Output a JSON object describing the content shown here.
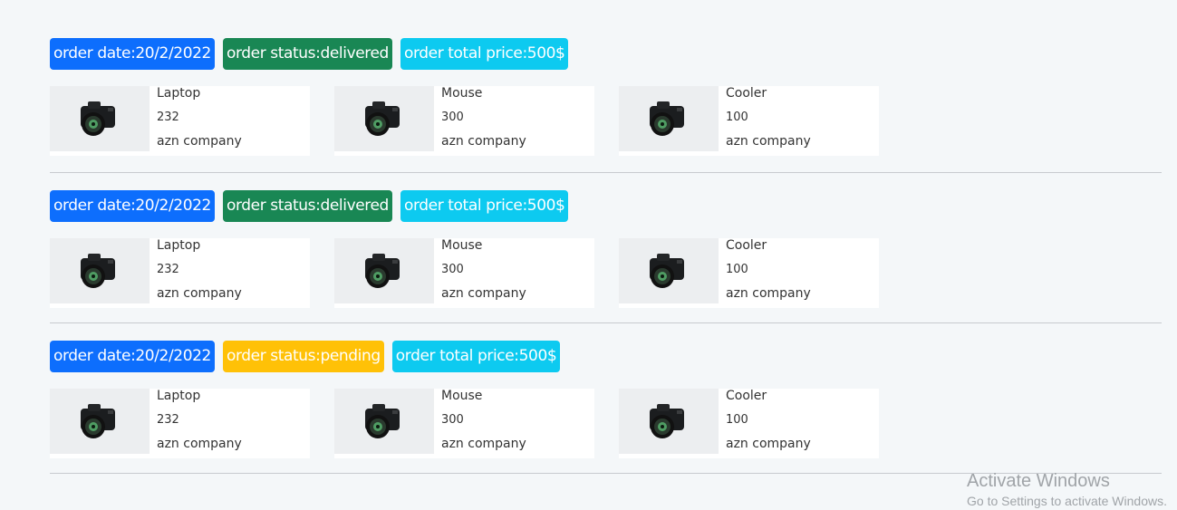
{
  "orders": [
    {
      "date_label": "order date:20/2/2022",
      "status_label": "order status:delivered",
      "status": "delivered",
      "total_label": "order total price:500$",
      "items": [
        {
          "name": "Laptop",
          "price": "232",
          "company": "azn company",
          "image_icon": "camera-icon"
        },
        {
          "name": "Mouse",
          "price": "300",
          "company": "azn company",
          "image_icon": "camera-icon"
        },
        {
          "name": "Cooler",
          "price": "100",
          "company": "azn company",
          "image_icon": "camera-icon"
        }
      ]
    },
    {
      "date_label": "order date:20/2/2022",
      "status_label": "order status:delivered",
      "status": "delivered",
      "total_label": "order total price:500$",
      "items": [
        {
          "name": "Laptop",
          "price": "232",
          "company": "azn company",
          "image_icon": "camera-icon"
        },
        {
          "name": "Mouse",
          "price": "300",
          "company": "azn company",
          "image_icon": "camera-icon"
        },
        {
          "name": "Cooler",
          "price": "100",
          "company": "azn company",
          "image_icon": "camera-icon"
        }
      ]
    },
    {
      "date_label": "order date:20/2/2022",
      "status_label": "order status:pending",
      "status": "pending",
      "total_label": "order total price:500$",
      "items": [
        {
          "name": "Laptop",
          "price": "232",
          "company": "azn company",
          "image_icon": "camera-icon"
        },
        {
          "name": "Mouse",
          "price": "300",
          "company": "azn company",
          "image_icon": "camera-icon"
        },
        {
          "name": "Cooler",
          "price": "100",
          "company": "azn company",
          "image_icon": "camera-icon"
        }
      ]
    }
  ],
  "colors": {
    "date_badge": "#0d6efd",
    "delivered_badge": "#198754",
    "pending_badge": "#ffc107",
    "total_badge": "#0dcaf0",
    "page_background": "#f4f7f9"
  },
  "watermark": {
    "title": "Activate Windows",
    "subtitle": "Go to Settings to activate Windows."
  }
}
